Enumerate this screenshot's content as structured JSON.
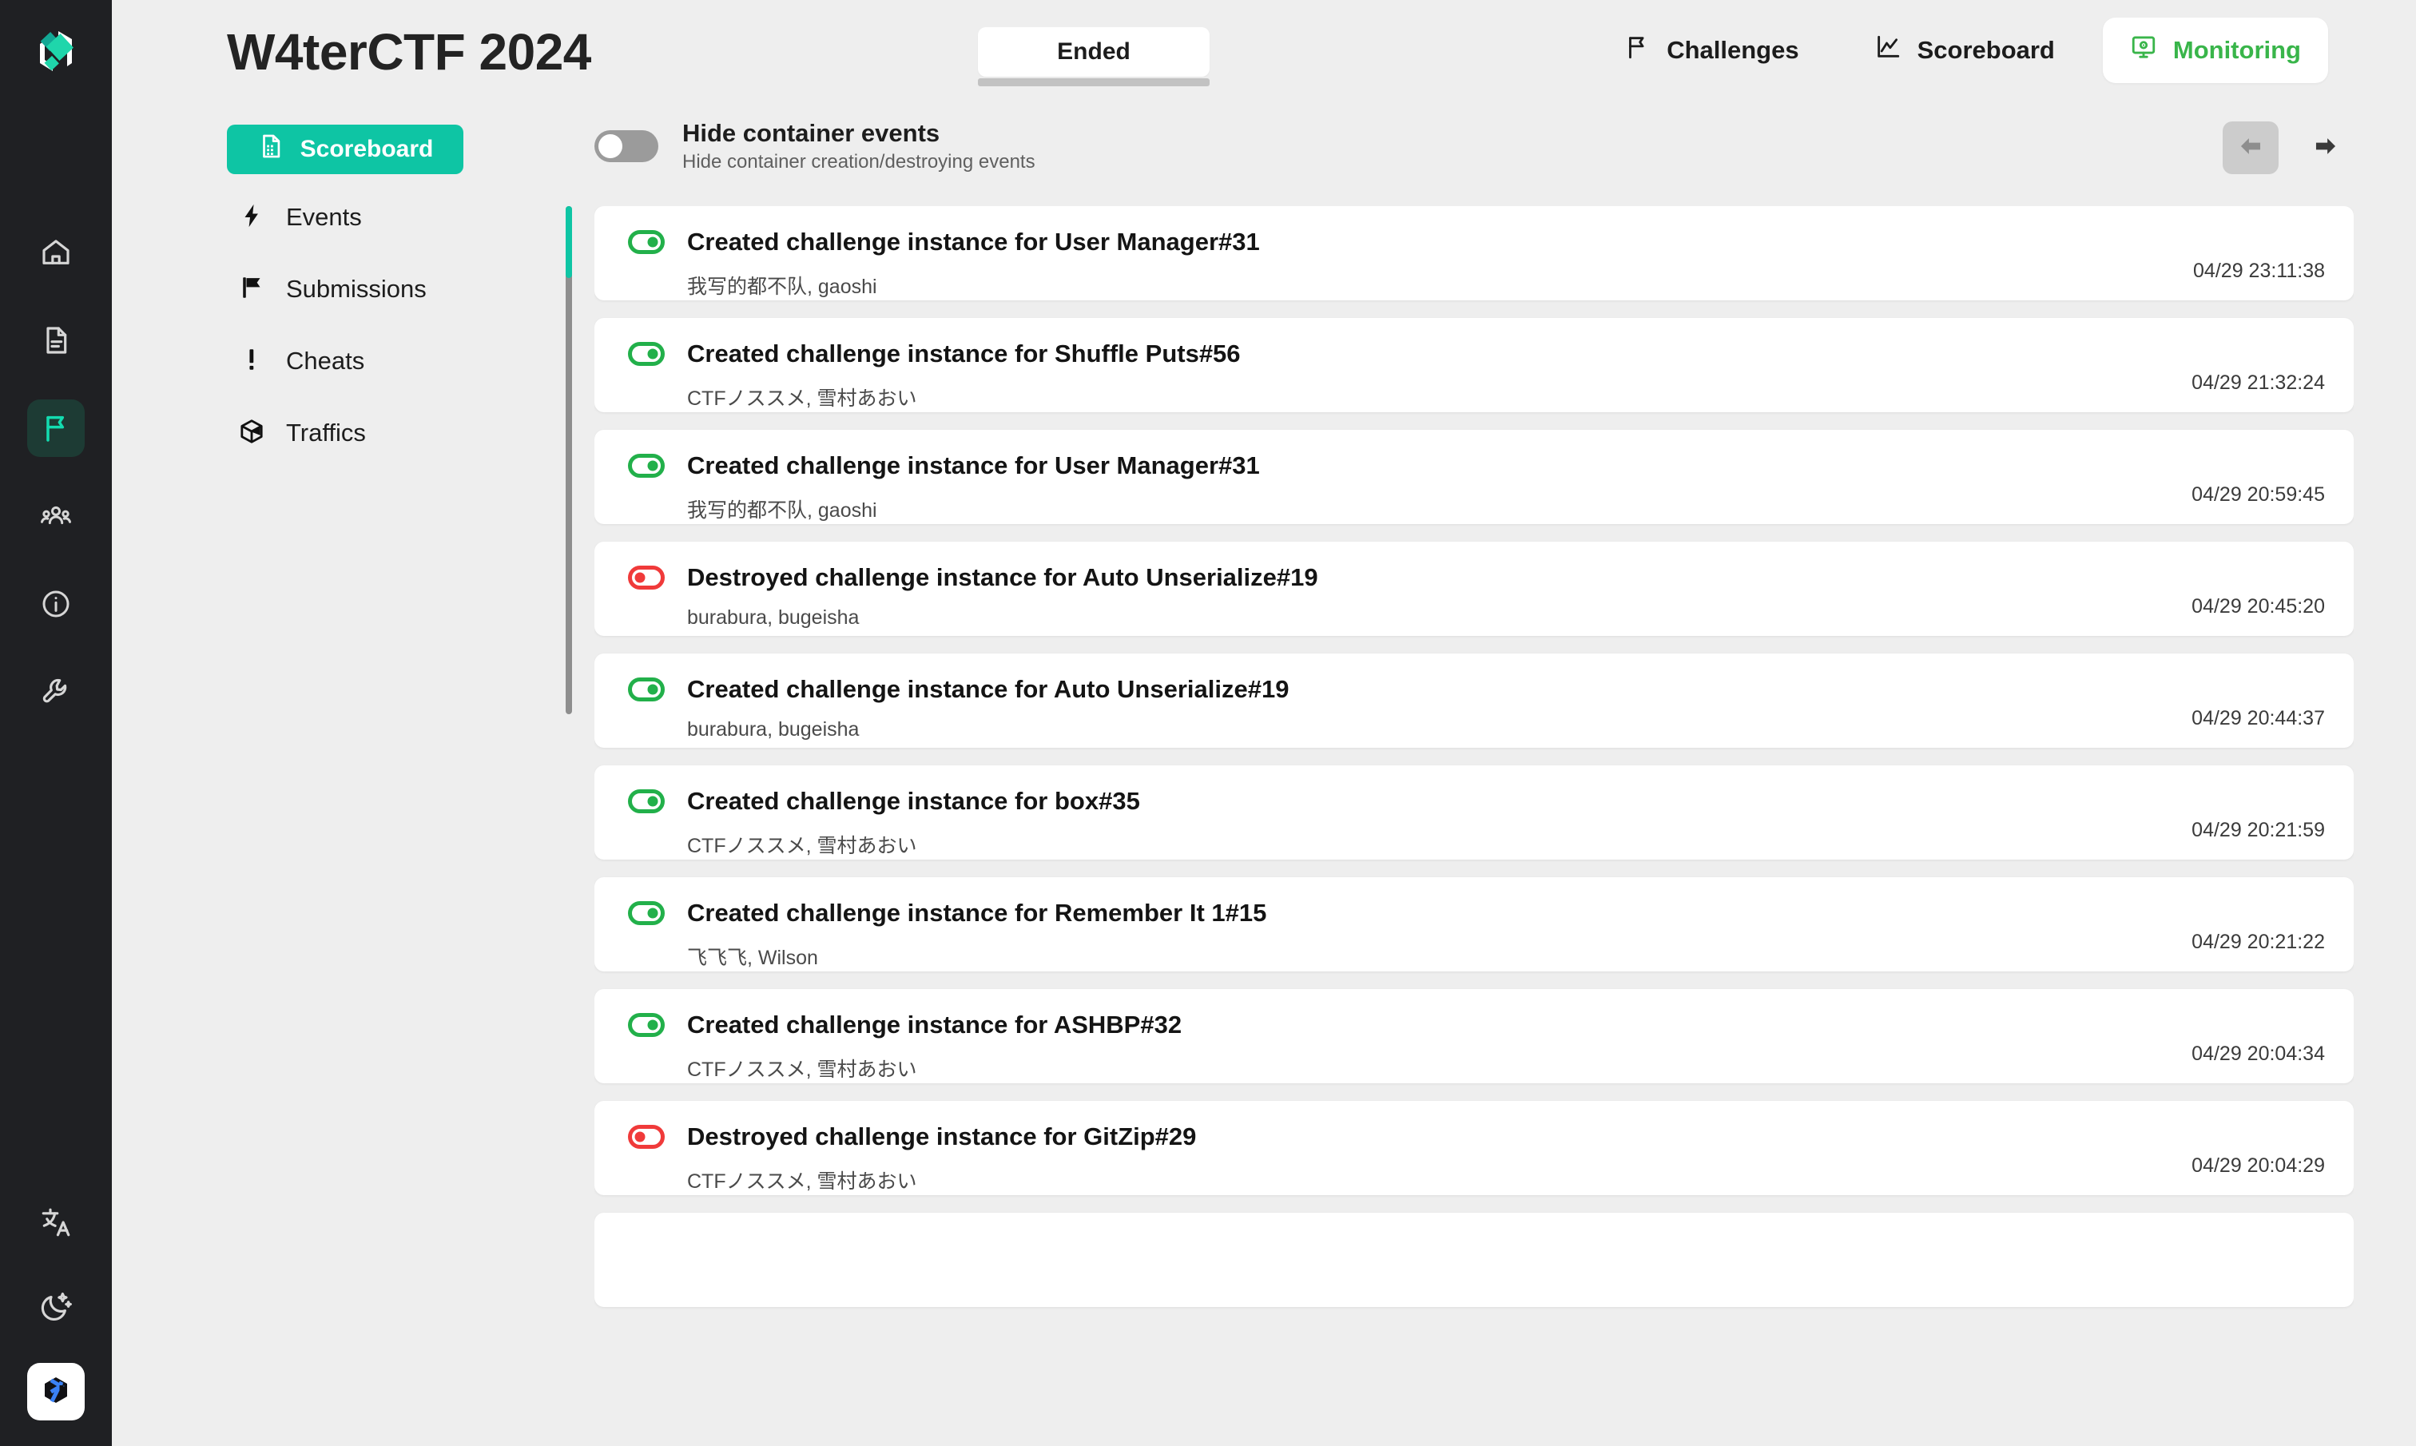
{
  "rail": {
    "logo_icon": "ctf-logo-icon",
    "items": [
      {
        "icon": "home-icon",
        "active": false
      },
      {
        "icon": "document-icon",
        "active": false
      },
      {
        "icon": "flag-icon",
        "active": true
      },
      {
        "icon": "users-icon",
        "active": false
      },
      {
        "icon": "info-icon",
        "active": false
      },
      {
        "icon": "wrench-icon",
        "active": false
      }
    ],
    "bottom": [
      {
        "icon": "translate-icon"
      },
      {
        "icon": "moon-icon"
      },
      {
        "icon": "user-avatar-icon"
      }
    ]
  },
  "header": {
    "title": "W4terCTF 2024",
    "status": "Ended",
    "nav": [
      {
        "label": "Challenges",
        "icon": "flag-icon",
        "active": false
      },
      {
        "label": "Scoreboard",
        "icon": "chart-line-icon",
        "active": false
      },
      {
        "label": "Monitoring",
        "icon": "monitor-icon",
        "active": true
      }
    ],
    "active_color": "#39b54a"
  },
  "toolbar": {
    "scoreboard_label": "Scoreboard",
    "scoreboard_icon": "spreadsheet-icon",
    "hide_toggle": {
      "title": "Hide container events",
      "subtitle": "Hide container creation/destroying events",
      "checked": false
    },
    "pager": {
      "prev_icon": "arrow-left-icon",
      "next_icon": "arrow-right-icon",
      "prev_disabled": true,
      "next_disabled": false
    }
  },
  "side_menu": {
    "active": "Events",
    "items": [
      {
        "label": "Events",
        "icon": "lightning-icon"
      },
      {
        "label": "Submissions",
        "icon": "flag-icon"
      },
      {
        "label": "Cheats",
        "icon": "exclamation-icon"
      },
      {
        "label": "Traffics",
        "icon": "box-icon"
      }
    ]
  },
  "events": [
    {
      "type": "created",
      "title": "Created challenge instance for User Manager#31",
      "meta": "我写的都不队, gaoshi",
      "time": "04/29 23:11:38"
    },
    {
      "type": "created",
      "title": "Created challenge instance for Shuffle Puts#56",
      "meta": "CTFノススメ, 雪村あおい",
      "time": "04/29 21:32:24"
    },
    {
      "type": "created",
      "title": "Created challenge instance for User Manager#31",
      "meta": "我写的都不队, gaoshi",
      "time": "04/29 20:59:45"
    },
    {
      "type": "destroyed",
      "title": "Destroyed challenge instance for Auto Unserialize#19",
      "meta": "burabura, bugeisha",
      "time": "04/29 20:45:20"
    },
    {
      "type": "created",
      "title": "Created challenge instance for Auto Unserialize#19",
      "meta": "burabura, bugeisha",
      "time": "04/29 20:44:37"
    },
    {
      "type": "created",
      "title": "Created challenge instance for box#35",
      "meta": "CTFノススメ, 雪村あおい",
      "time": "04/29 20:21:59"
    },
    {
      "type": "created",
      "title": "Created challenge instance for Remember It 1#15",
      "meta": "飞飞飞, Wilson",
      "time": "04/29 20:21:22"
    },
    {
      "type": "created",
      "title": "Created challenge instance for ASHBP#32",
      "meta": "CTFノススメ, 雪村あおい",
      "time": "04/29 20:04:34"
    },
    {
      "type": "destroyed",
      "title": "Destroyed challenge instance for GitZip#29",
      "meta": "CTFノススメ, 雪村あおい",
      "time": "04/29 20:04:29"
    }
  ],
  "colors": {
    "teal": "#0ec5a4",
    "created_green": "#22b04a",
    "destroyed_red": "#f03a3a",
    "rail_bg": "#1f2023",
    "page_bg": "#eeeeee"
  }
}
